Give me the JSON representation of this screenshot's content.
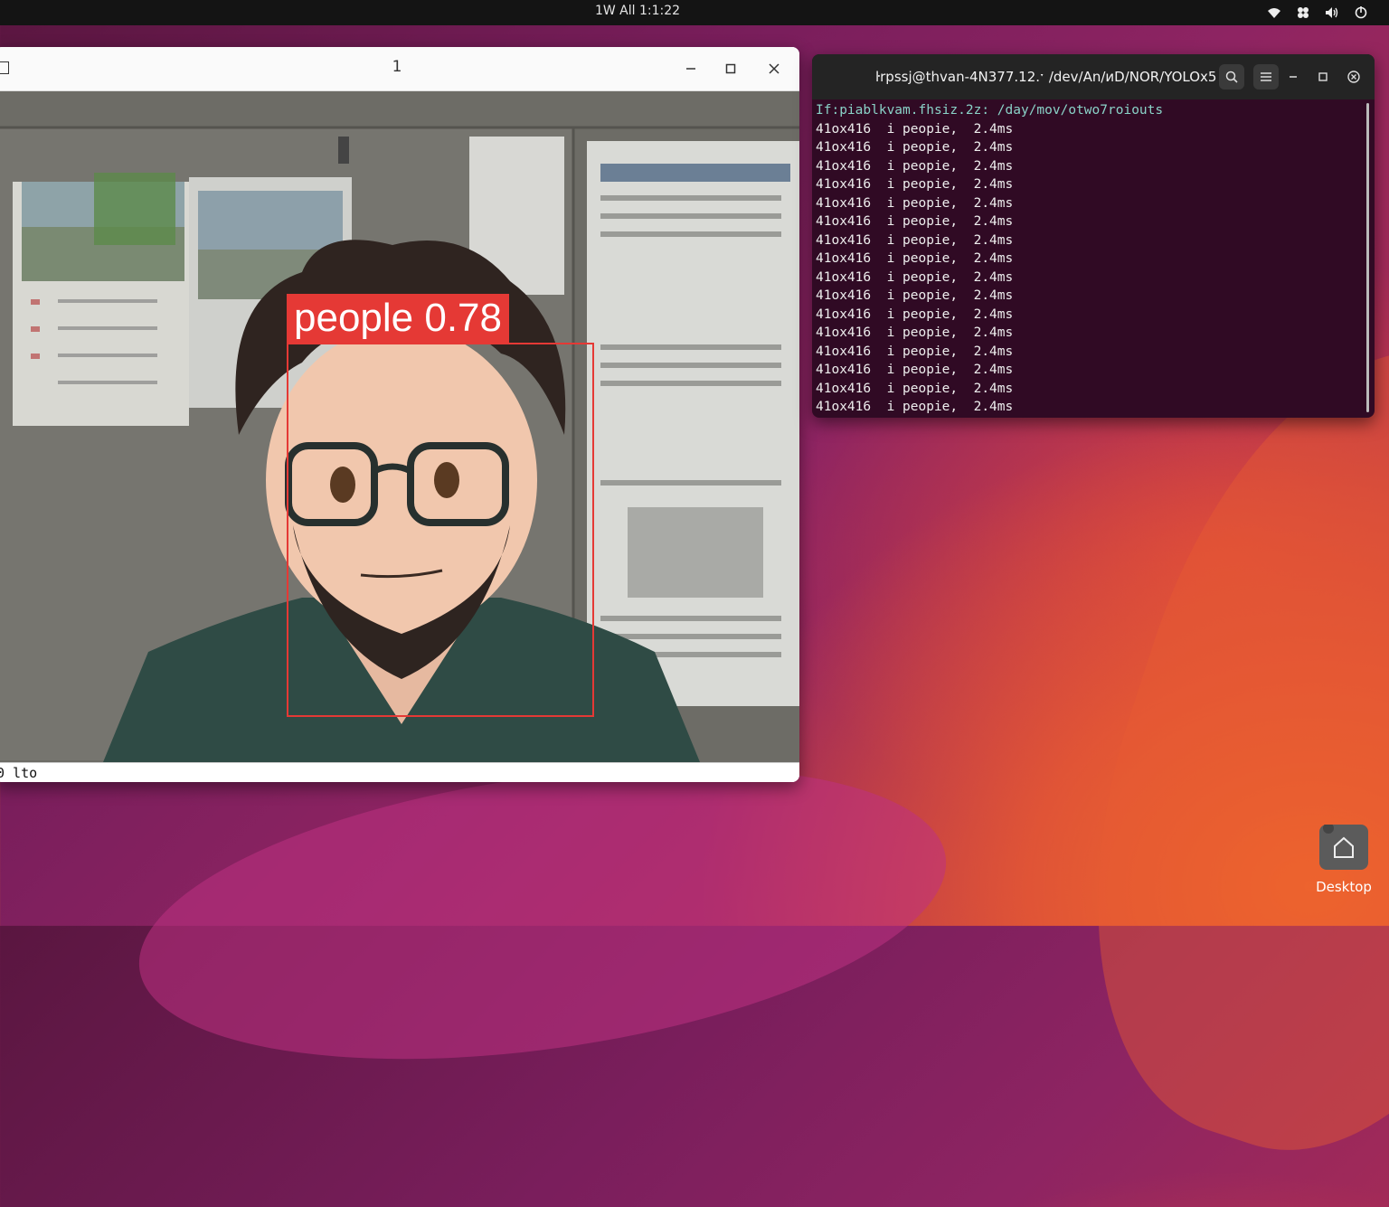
{
  "topbar": {
    "clock": "1W All  1:1:22",
    "tray_icons": [
      "wifi-icon",
      "network-icon",
      "volume-icon",
      "power-icon"
    ]
  },
  "viewer": {
    "title": "1",
    "detection": {
      "label": "people 0.78",
      "box_color": "#e53935"
    },
    "status": "0 lto"
  },
  "terminal": {
    "title": "ŀrpssj@thvan-4N377.12.ˑ /dev/An/иD/NOR/YOLOx5",
    "prompt": "If:piablkvam.fhsiz.2z: /day/mov/otwo7roiouts",
    "lines": [
      "41ox416  i peopie,  2.4ms",
      "41ox416  i peopie,  2.4ms",
      "41ox416  i peopie,  2.4ms",
      "41ox416  i peopie,  2.4ms",
      "41ox416  i peopie,  2.4ms",
      "41ox416  i peopie,  2.4ms",
      "41ox416  i peopie,  2.4ms",
      "41ox416  i peopie,  2.4ms",
      "41ox416  i peopie,  2.4ms",
      "41ox416  i peopie,  2.4ms",
      "41ox416  i peopie,  2.4ms",
      "41ox416  i peopie,  2.4ms",
      "41ox416  i peopie,  2.4ms",
      "41ox416  i peopie,  2.4ms",
      "41ox416  i peopie,  2.4ms",
      "41ox416  i peopie,  2.4ms"
    ]
  },
  "desktop_icon": {
    "label": "Desktop"
  }
}
